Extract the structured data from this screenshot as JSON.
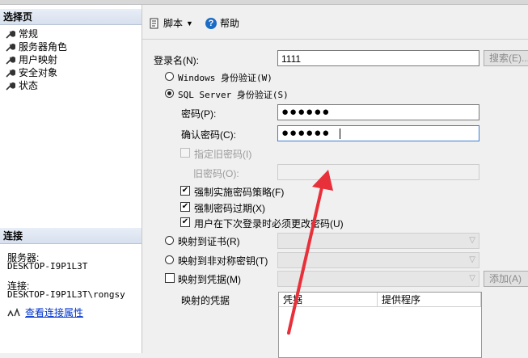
{
  "left": {
    "select_page_header": "选择页",
    "nav_items": [
      {
        "label": "常规"
      },
      {
        "label": "服务器角色"
      },
      {
        "label": "用户映射"
      },
      {
        "label": "安全对象"
      },
      {
        "label": "状态"
      }
    ],
    "connection_header": "连接",
    "server_label": "服务器:",
    "server_value": "DESKTOP-I9P1L3T",
    "connection_label": "连接:",
    "connection_value": "DESKTOP-I9P1L3T\\rongsy",
    "view_props_link": "查看连接属性"
  },
  "toolbar": {
    "script_label": "脚本",
    "help_label": "帮助"
  },
  "form": {
    "login_name_label": "登录名(N):",
    "login_name_value": "1111",
    "search_button": "搜索(E)...",
    "windows_auth": "Windows 身份验证(W)",
    "sql_auth": "SQL Server 身份验证(S)",
    "password_label": "密码(P):",
    "password_mask": "●●●●●●",
    "confirm_label": "确认密码(C):",
    "confirm_mask": "●●●●●●",
    "specify_old": "指定旧密码(I)",
    "old_password_label": "旧密码(O):",
    "enforce_policy": "强制实施密码策略(F)",
    "enforce_expiration": "强制密码过期(X)",
    "must_change": "用户在下次登录时必须更改密码(U)",
    "map_cert": "映射到证书(R)",
    "map_asym": "映射到非对称密钥(T)",
    "map_credential": "映射到凭据(M)",
    "add_button": "添加(A)",
    "mapped_credentials": "映射的凭据",
    "grid_col1": "凭据",
    "grid_col2": "提供程序"
  },
  "colors": {
    "arrow": "#e8303a",
    "link": "#0033cc"
  }
}
